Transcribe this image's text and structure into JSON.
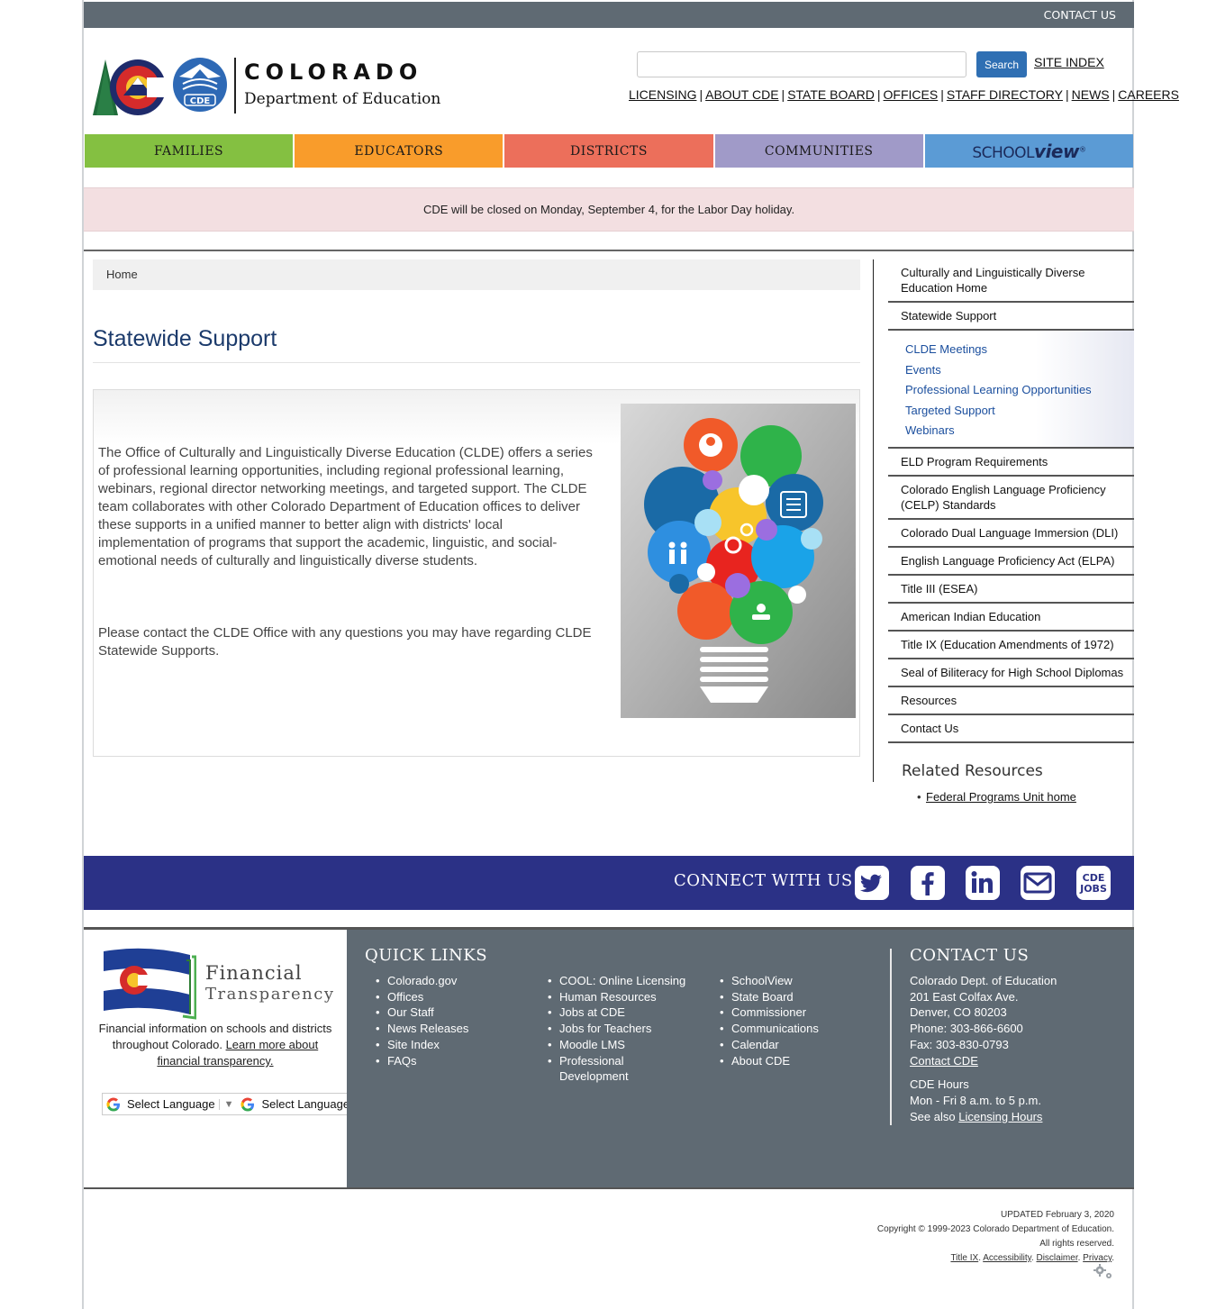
{
  "topbar": {
    "contact_label": "CONTACT US"
  },
  "header": {
    "logo_title": "COLORADO",
    "logo_subtitle": "Department of Education",
    "logo_badge": "CDE",
    "search_placeholder": "",
    "search_button": "Search",
    "site_index": "SITE INDEX",
    "util_links": [
      "LICENSING",
      "ABOUT CDE",
      "STATE BOARD",
      "OFFICES",
      "STAFF DIRECTORY",
      "NEWS",
      "CAREERS"
    ]
  },
  "mainnav": {
    "families": "FAMILIES",
    "educators": "EDUCATORS",
    "districts": "DISTRICTS",
    "communities": "COMMUNITIES",
    "schoolview_a": "SCHOOL",
    "schoolview_b": "view"
  },
  "alert": {
    "text": "CDE will be closed on Monday, September 4, for the Labor Day holiday."
  },
  "breadcrumb": {
    "home": "Home"
  },
  "main": {
    "title": "Statewide Support",
    "para1": "The Office of Culturally and Linguistically Diverse Education (CLDE) offers a series of professional learning opportunities, including regional professional learning, webinars, regional director networking meetings, and targeted support. The CLDE team collaborates with other Colorado Department of Education offices to deliver these supports in a unified manner to better align with districts' local implementation of programs that support the academic, linguistic, and social-emotional needs of culturally and linguistically diverse students.",
    "para2": "Please contact the CLDE Office with any questions you may have regarding CLDE Statewide Supports."
  },
  "sidebar": {
    "items_top": [
      "Culturally and Linguistically Diverse Education Home",
      "Statewide Support"
    ],
    "sub_items": [
      "CLDE Meetings",
      "Events",
      "Professional Learning Opportunities",
      "Targeted Support",
      "Webinars"
    ],
    "items_bottom": [
      "ELD Program Requirements",
      "Colorado English Language Proficiency (CELP) Standards",
      "Colorado Dual Language Immersion (DLI)",
      "English Language Proficiency Act (ELPA)",
      "Title III (ESEA)",
      "American Indian Education",
      "Title IX (Education Amendments of 1972)",
      "Seal of Biliteracy for High School Diplomas",
      "Resources",
      "Contact Us"
    ],
    "related_title": "Related Resources",
    "related_link": "Federal Programs Unit home"
  },
  "connect": {
    "label": "CONNECT WITH US",
    "jobs_line1": "CDE",
    "jobs_line2": "JOBS"
  },
  "footer": {
    "ft_title1": "Financial",
    "ft_title2": "Transparency",
    "ft_desc": "Financial information on schools and districts throughout Colorado.",
    "ft_link": "Learn more about financial transparency.",
    "lang1": "Select Language",
    "lang2": "Select Language",
    "quick_title": "QUICK LINKS",
    "ql_col1": [
      "Colorado.gov",
      "Offices",
      "Our Staff",
      "News Releases",
      "Site Index",
      "FAQs"
    ],
    "ql_col2": [
      "COOL: Online Licensing",
      "Human Resources",
      "Jobs at CDE",
      "Jobs for Teachers",
      "Moodle LMS",
      "Professional Development"
    ],
    "ql_col3": [
      "SchoolView",
      "State Board",
      "Commissioner",
      "Communications",
      "Calendar",
      "About CDE"
    ],
    "contact_title": "CONTACT US",
    "contact_lines": [
      "Colorado Dept. of Education",
      "201 East Colfax Ave.",
      "Denver, CO 80203",
      "Phone: 303-866-6600",
      "Fax: 303-830-0793"
    ],
    "contact_link": "Contact CDE",
    "hours_title": "CDE Hours",
    "hours_line": "Mon - Fri 8 a.m. to 5 p.m.",
    "see_also": "See also",
    "hours_link": "Licensing Hours"
  },
  "legal": {
    "updated": "UPDATED February 3, 2020",
    "copyright": "Copyright © 1999-2023 Colorado Department of Education.",
    "rights": "All rights reserved.",
    "links": [
      "Title IX",
      "Accessibility",
      "Disclaimer",
      "Privacy"
    ]
  },
  "colors": {
    "families": "#84c041",
    "educators": "#f99c2b",
    "districts": "#ec6f5b",
    "communities": "#a09ac8",
    "schoolview": "#5b9bd5",
    "connect_bar": "#2b3186",
    "footer_bg": "#5f6a73",
    "title_blue": "#1b3a6b"
  },
  "icons": [
    "twitter-icon",
    "facebook-icon",
    "linkedin-icon",
    "email-icon",
    "cde-jobs-icon",
    "google-icon",
    "gear-icon"
  ]
}
